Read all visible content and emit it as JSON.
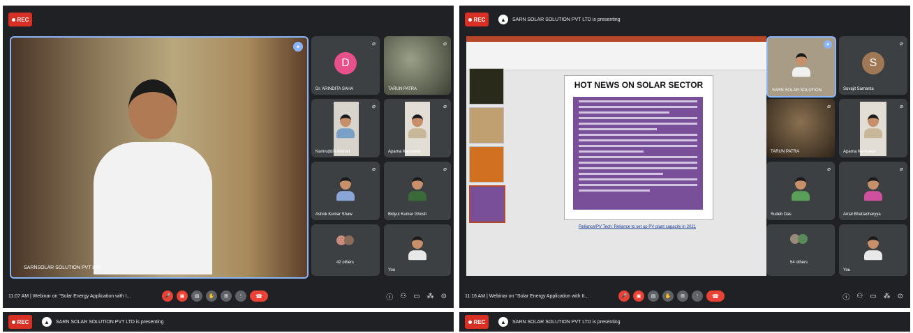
{
  "left": {
    "rec_label": "REC",
    "main_name": "SARNSOLAR SOLUTION PVT LTD",
    "tiles": [
      {
        "name": "Dr. ARINDITA SAHA",
        "avatar": "D",
        "color": "#e8508b"
      },
      {
        "name": "TARUN PATRA"
      },
      {
        "name": "Kamruddin Ahmed"
      },
      {
        "name": "Aparna Karmakar"
      },
      {
        "name": "Ashok Kumar Shaw"
      },
      {
        "name": "Bidyut Kumar Ghosh"
      },
      {
        "name": "42 others"
      },
      {
        "name": "You"
      }
    ],
    "time": "11:07 AM",
    "meeting": "Webinar on \"Solar Energy Application with I...",
    "bottom_presenting": "SARN SOLAR SOLUTION PVT LTD is presenting"
  },
  "right": {
    "rec_label": "REC",
    "presenting": "SARN SOLAR SOLUTION PVT LTD is presenting",
    "slide_title": "HOT NEWS ON SOLAR SECTOR",
    "slide_link": "Reliance/PV Tech: Reliance to set up PV plant capacity in 2021",
    "tiles": [
      {
        "name": "SARN SOLAR SOLUTION"
      },
      {
        "name": "Suvajit Samanta",
        "avatar": "S",
        "color": "#a07855"
      },
      {
        "name": "TARUN PATRA"
      },
      {
        "name": "Aparna Karmakar"
      },
      {
        "name": "Sudeb Das"
      },
      {
        "name": "Amal Bhattacharyya"
      },
      {
        "name": "54 others"
      },
      {
        "name": "You"
      }
    ],
    "time": "11:16 AM",
    "meeting": "Webinar on \"Solar Energy Application with It...",
    "bottom_presenting": "SARN SOLAR SOLUTION PVT LTD is presenting"
  },
  "icons": [
    "mic-icon",
    "camera-icon",
    "captions-icon",
    "hand-icon",
    "present-icon",
    "more-icon",
    "end-call-icon"
  ]
}
